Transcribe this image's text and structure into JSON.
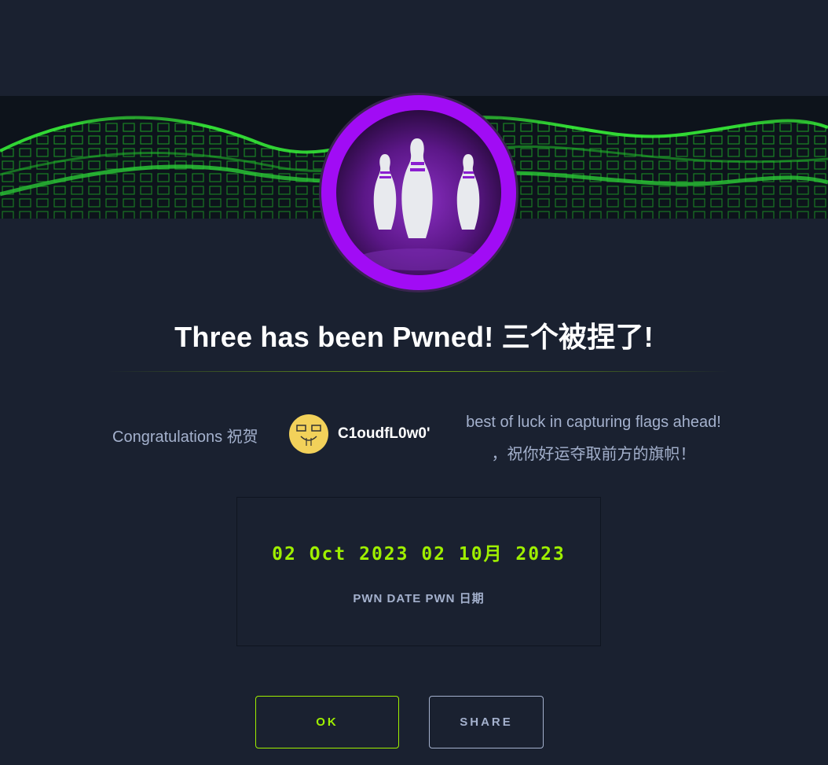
{
  "header": {
    "title": "Three has been Pwned! 三个被捏了!",
    "badge_icon": "bowling-pins-icon",
    "banner_icon": "green-cube-wave-icon"
  },
  "message": {
    "congrats": "Congratulations  祝贺",
    "username": "C1oudfL0w0'",
    "avatar_icon": "user-avatar-icon",
    "luck_line1": "best of luck in capturing flags ahead!",
    "luck_line2": "，祝你好运夺取前方的旗帜！"
  },
  "pwn": {
    "date": "02 Oct 2023 02 10月 2023",
    "label": "PWN DATE PWN 日期"
  },
  "actions": {
    "ok_label": "OK",
    "share_label": "SHARE"
  },
  "colors": {
    "background": "#1a2130",
    "accent": "#9fef00",
    "badge_ring": "#a10cf5",
    "muted_text": "#a4b1cd"
  }
}
